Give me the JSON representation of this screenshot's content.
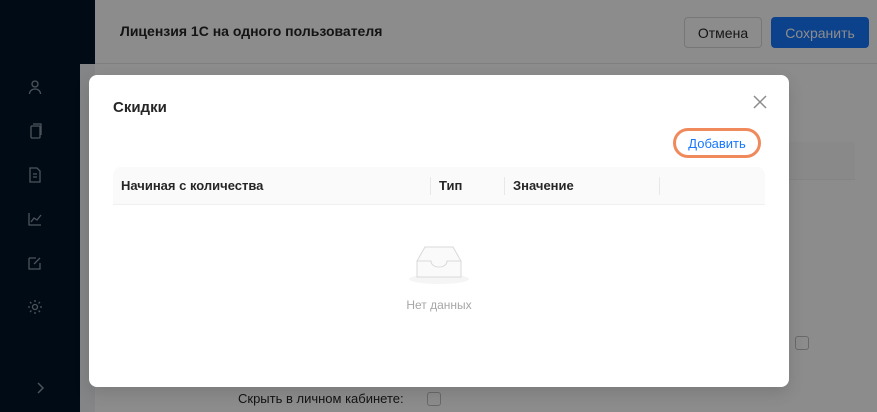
{
  "header": {
    "title": "Лицензия 1С на одного пользователя",
    "cancel_label": "Отмена",
    "save_label": "Сохранить"
  },
  "sidebar": {
    "icons": [
      "user-icon",
      "copy-icon",
      "document-icon",
      "chart-icon",
      "edit-icon",
      "gear-icon",
      "chevron-right-icon"
    ]
  },
  "form": {
    "hide_label": "Скрыть в личном кабинете:"
  },
  "modal": {
    "title": "Скидки",
    "add_label": "Добавить",
    "columns": [
      "Начиная с количества",
      "Тип",
      "Значение"
    ],
    "empty_text": "Нет данных"
  },
  "colors": {
    "primary": "#1677ff",
    "sidebar": "#001529",
    "highlight": "#f08a5d"
  }
}
